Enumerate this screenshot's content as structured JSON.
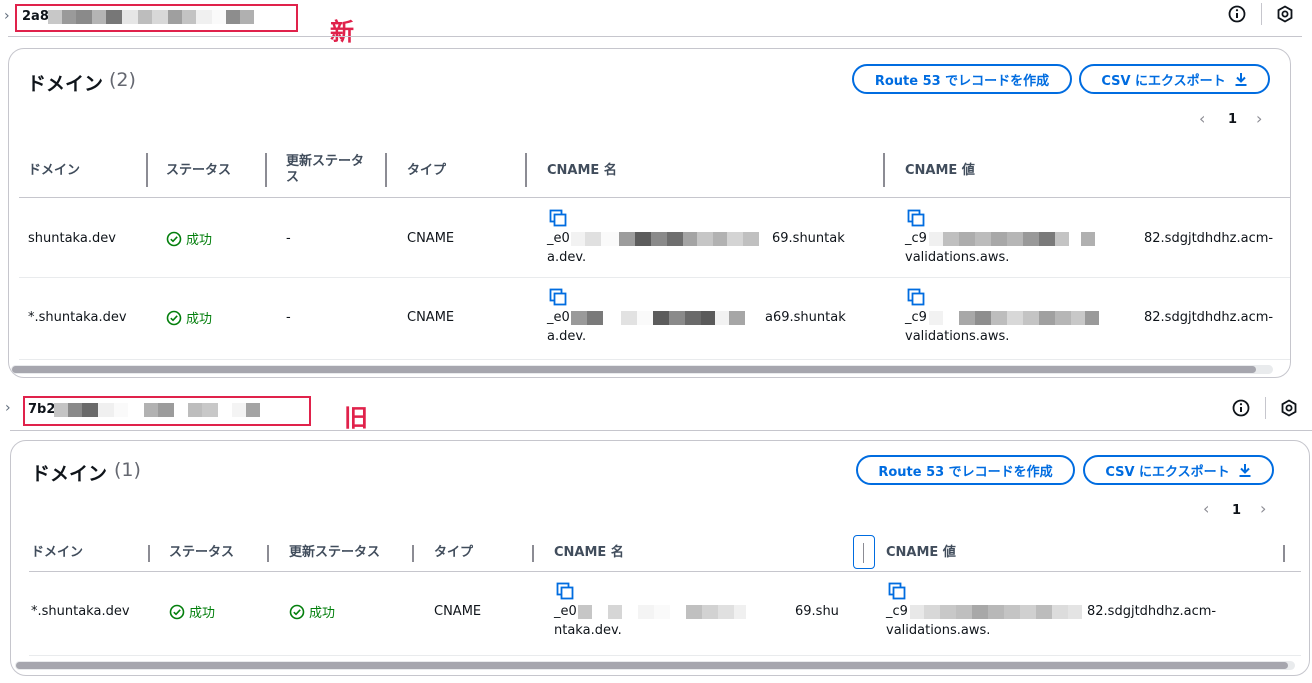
{
  "sections": [
    {
      "cert_id_prefix": "2a8",
      "annotation": "新",
      "panel": {
        "title": "ドメイン",
        "count": "(2)",
        "create_button": "Route 53 でレコードを作成",
        "export_button": "CSV にエクスポート",
        "page": "1",
        "columns": [
          "ドメイン",
          "ステータス",
          "更新ステータス",
          "タイプ",
          "CNAME 名",
          "CNAME 値"
        ],
        "rows": [
          {
            "domain": "shuntaka.dev",
            "status": "成功",
            "renewal": "-",
            "type": "CNAME",
            "cname_name_prefix": "_e0",
            "cname_name_suffix": "69.shuntak",
            "cname_name_line2": "a.dev.",
            "cname_value_prefix": "_c9",
            "cname_value_suffix": "82.sdgjtdhdhz.acm-",
            "cname_value_line2": "validations.aws."
          },
          {
            "domain": "*.shuntaka.dev",
            "status": "成功",
            "renewal": "-",
            "type": "CNAME",
            "cname_name_prefix": "_e0",
            "cname_name_suffix": "a69.shuntak",
            "cname_name_line2": "a.dev.",
            "cname_value_prefix": "_c9",
            "cname_value_suffix": "82.sdgjtdhdhz.acm-",
            "cname_value_line2": "validations.aws."
          }
        ]
      }
    },
    {
      "cert_id_prefix": "7b2",
      "annotation": "旧",
      "panel": {
        "title": "ドメイン",
        "count": "(1)",
        "create_button": "Route 53 でレコードを作成",
        "export_button": "CSV にエクスポート",
        "page": "1",
        "columns": [
          "ドメイン",
          "ステータス",
          "更新ステータス",
          "タイプ",
          "CNAME 名",
          "CNAME 値"
        ],
        "rows": [
          {
            "domain": "*.shuntaka.dev",
            "status": "成功",
            "renewal": "成功",
            "type": "CNAME",
            "cname_name_prefix": "_e0",
            "cname_name_suffix": "69.shu",
            "cname_name_line2": "ntaka.dev.",
            "cname_value_prefix": "_c9",
            "cname_value_suffix": "82.sdgjtdhdhz.acm-",
            "cname_value_line2": "validations.aws."
          }
        ]
      }
    }
  ],
  "colors": {
    "accent": "#006ce0",
    "success": "#037f0c",
    "annotation": "#e0224b"
  },
  "icons": [
    "info-icon",
    "settings-hex-icon",
    "download-icon",
    "copy-icon",
    "success-check-icon",
    "chevron-left-icon",
    "chevron-right-icon",
    "expand-chevron-icon"
  ]
}
